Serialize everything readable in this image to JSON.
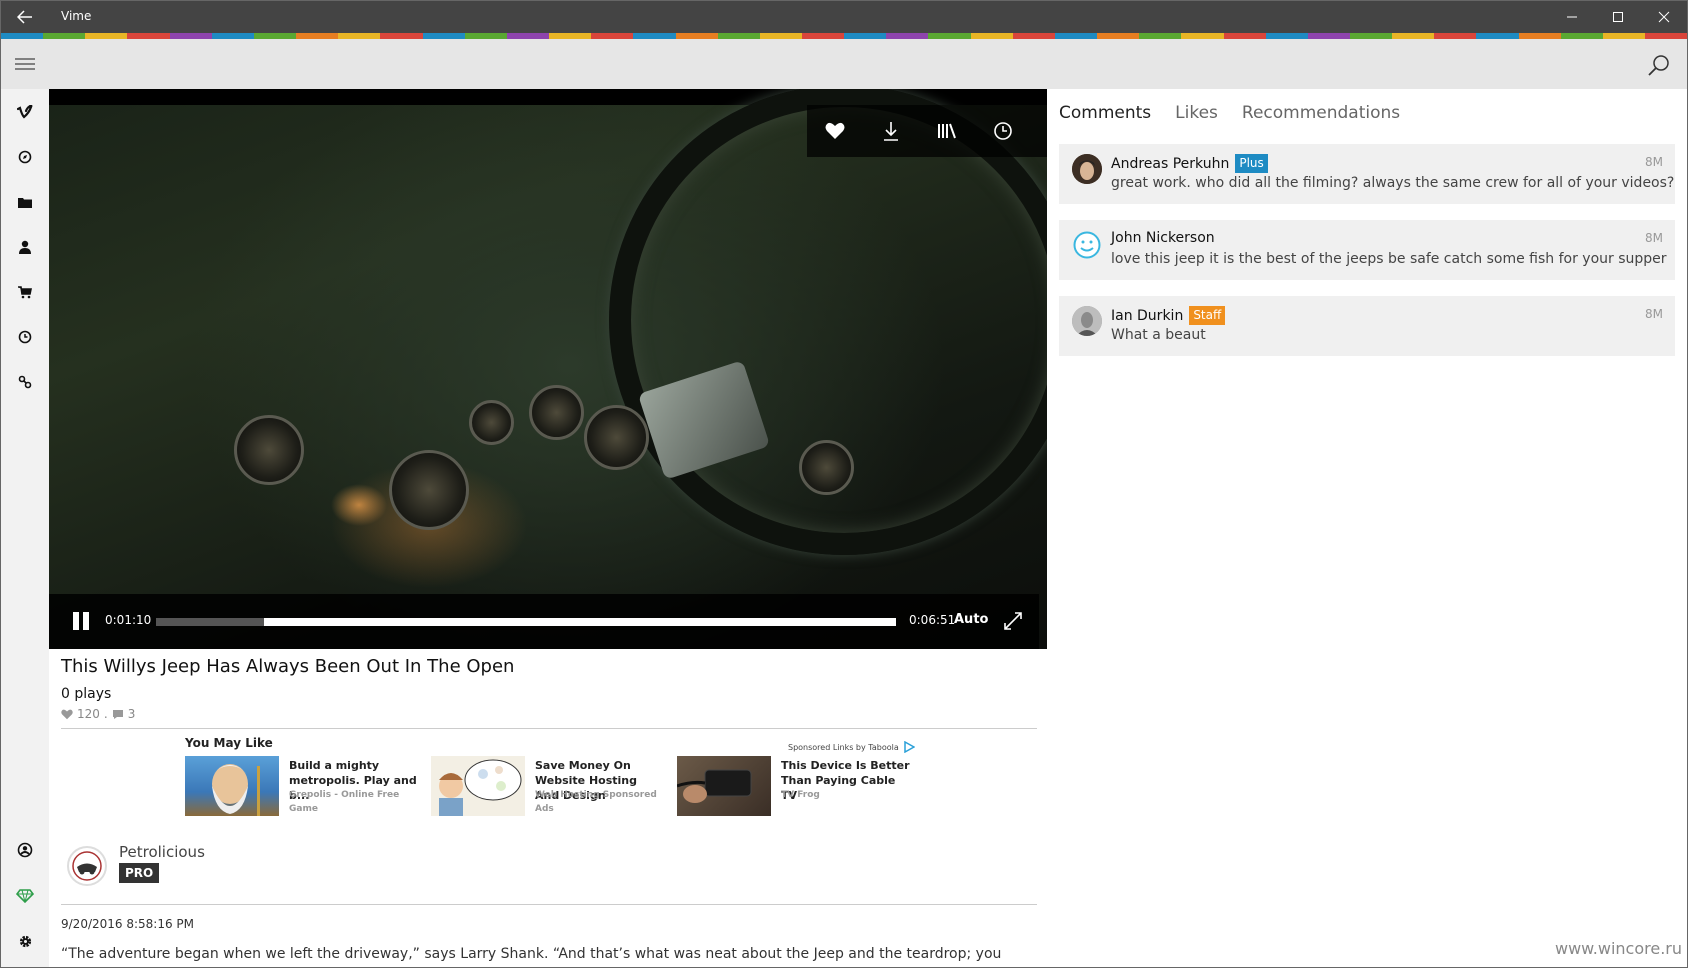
{
  "window": {
    "title": "Vime"
  },
  "stripe_colors": [
    "#1e8bc3",
    "#5aa832",
    "#e8b526",
    "#d9453b",
    "#8e44ad",
    "#1e8bc3",
    "#5aa832",
    "#e67e22",
    "#e8b526",
    "#d9453b",
    "#1e8bc3",
    "#5aa832",
    "#8e44ad",
    "#e8b526",
    "#d9453b",
    "#1e8bc3",
    "#e67e22",
    "#5aa832",
    "#e8b526",
    "#d9453b",
    "#1e8bc3",
    "#8e44ad",
    "#5aa832",
    "#e8b526",
    "#d9453b",
    "#1e8bc3",
    "#e67e22",
    "#5aa832",
    "#e8b526",
    "#d9453b",
    "#1e8bc3",
    "#8e44ad",
    "#5aa832",
    "#e8b526",
    "#d9453b",
    "#1e8bc3",
    "#e67e22",
    "#5aa832",
    "#e8b526",
    "#d9453b"
  ],
  "sidebar": {
    "top": [
      "vimeo-logo-icon",
      "compass-icon",
      "folder-icon",
      "person-icon",
      "cart-icon",
      "clock-icon",
      "link-icon"
    ],
    "bottom": [
      "account-icon",
      "gem-icon",
      "gear-icon"
    ]
  },
  "player": {
    "current_time": "0:01:10",
    "duration": "0:06:51",
    "quality": "Auto",
    "progress_fraction": 0.146
  },
  "video": {
    "title": "This Willys Jeep Has Always Been Out In The Open",
    "plays": "0 plays",
    "likes": "120",
    "separator": ".",
    "comments_count": "3"
  },
  "ads": {
    "title": "You May Like",
    "sponsored": "Sponsored Links by Taboola",
    "items": [
      {
        "title": "Build a mighty metropolis. Play and b...",
        "source": "Grepolis - Online Free Game"
      },
      {
        "title": "Save Money On Website Hosting And Design",
        "source": "Web Hosting Sponsored Ads"
      },
      {
        "title": "This Device Is Better Than Paying Cable TV",
        "source": "TV Frog"
      }
    ]
  },
  "owner": {
    "name": "Petrolicious",
    "badge": "PRO"
  },
  "publish_date": "9/20/2016 8:58:16 PM",
  "description": "“The adventure began when we left the driveway,” says Larry Shank. “And that’s what was neat about the Jeep and the teardrop; you became part",
  "tabs": [
    "Comments",
    "Likes",
    "Recommendations"
  ],
  "comments": [
    {
      "name": "Andreas Perkuhn",
      "badge": "Plus",
      "badge_color": "#1e8bc3",
      "text": "great work. who did all the filming? always the same crew for all of your videos?",
      "time": "8M"
    },
    {
      "name": "John Nickerson",
      "badge": "",
      "badge_color": "",
      "text": "love this jeep it is the best of the jeeps be safe catch some fish for your supper",
      "time": "8M"
    },
    {
      "name": "Ian Durkin",
      "badge": "Staff",
      "badge_color": "#f0901e",
      "text": "What a beaut",
      "time": "8M"
    }
  ],
  "watermark": "www.wincore.ru"
}
